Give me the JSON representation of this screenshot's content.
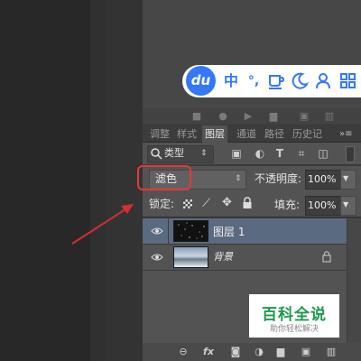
{
  "ime_toolbar": {
    "logo": "du",
    "chinese_mode": "中",
    "punctuation": "°,",
    "cup_icon": "cup-icon",
    "moon_icon": "moon-icon",
    "grid_icon": "grid-icon"
  },
  "tabs": [
    {
      "label": "调整"
    },
    {
      "label": "样式"
    },
    {
      "label": "图层",
      "active": true
    },
    {
      "label": "通道"
    },
    {
      "label": "路径"
    },
    {
      "label": "历史记"
    }
  ],
  "filter": {
    "kind_label": "类型"
  },
  "blend": {
    "mode": "滤色",
    "opacity_label": "不透明度:",
    "opacity_value": "100%"
  },
  "lock": {
    "label": "锁定:",
    "fill_label": "填充:",
    "fill_value": "100%"
  },
  "layers": [
    {
      "name": "图层 1",
      "selected": true
    },
    {
      "name": "背景",
      "locked": true
    }
  ],
  "watermark": {
    "title": "百科全说",
    "subtitle": "助你轻松解决"
  },
  "colors": {
    "highlight": "#e53935",
    "arrow": "#d32f2f",
    "selected_row": "#5a6a80",
    "ime_blue": "#3478f6"
  }
}
